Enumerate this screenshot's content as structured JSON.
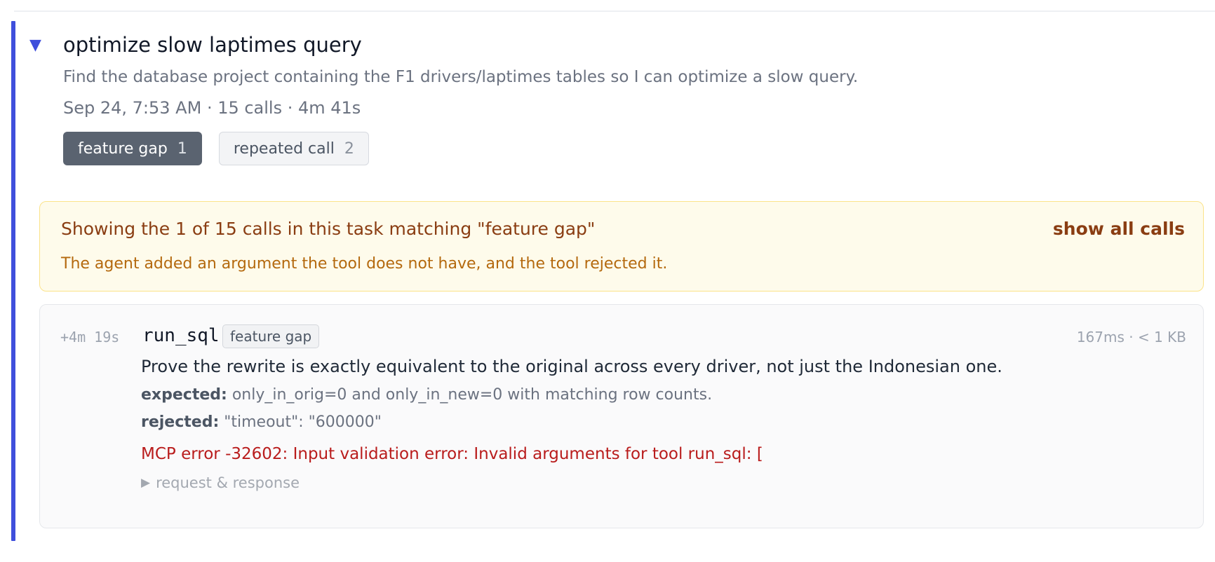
{
  "task": {
    "title": "optimize slow laptimes query",
    "description": "Find the database project containing the F1 drivers/laptimes tables so I can optimize a slow query.",
    "meta": "Sep 24, 7:53 AM · 15 calls · 4m 41s",
    "toggle_glyph": "▼",
    "tags": [
      {
        "label": "feature gap",
        "count": "1",
        "active": true
      },
      {
        "label": "repeated call",
        "count": "2",
        "active": false
      }
    ]
  },
  "filter_banner": {
    "headline": "Showing the 1 of 15 calls in this task matching \"feature gap\"",
    "action_label": "show all calls",
    "note": "The agent added an argument the tool does not have, and the tool rejected it."
  },
  "call": {
    "offset": "+4m 19s",
    "name": "run_sql",
    "tag": "feature gap",
    "stats": "167ms · < 1 KB",
    "goal": "Prove the rewrite is exactly equivalent to the original across every driver, not just the Indonesian one.",
    "expected_label": "expected:",
    "expected_value": "only_in_orig=0 and only_in_new=0 with matching row counts.",
    "rejected_label": "rejected:",
    "rejected_value": "\"timeout\": \"600000\"",
    "error": "MCP error -32602: Input validation error: Invalid arguments for tool run_sql: [",
    "details_glyph": "▶",
    "details_label": "request & response"
  },
  "colors": {
    "accent": "#3f4fdc",
    "banner_background": "#fefbeb",
    "banner_text": "#8a3d12",
    "banner_note": "#b4690e",
    "error": "#b91c1c",
    "active_tag": "#5a6370"
  }
}
